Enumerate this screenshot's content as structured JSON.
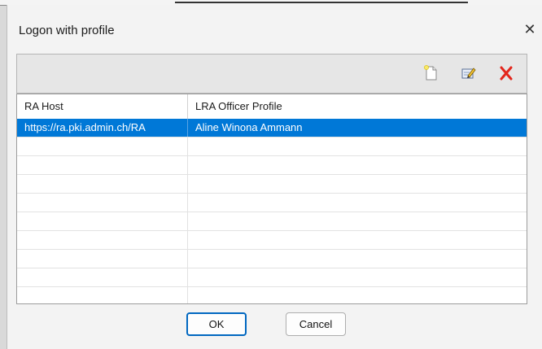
{
  "dialog": {
    "title": "Logon with profile",
    "close_glyph": "✕"
  },
  "toolbar": {
    "buttons": [
      {
        "name": "new-profile-button",
        "icon": "new-document-icon"
      },
      {
        "name": "edit-profile-button",
        "icon": "edit-icon"
      },
      {
        "name": "delete-profile-button",
        "icon": "delete-x-icon"
      }
    ]
  },
  "table": {
    "columns": [
      "RA Host",
      "LRA Officer Profile"
    ],
    "rows": [
      {
        "host": "https://ra.pki.admin.ch/RA",
        "profile": "Aline Winona Ammann",
        "selected": true
      }
    ],
    "empty_rows": 9
  },
  "buttons": {
    "ok_label": "OK",
    "cancel_label": "Cancel"
  },
  "colors": {
    "selection": "#0078d7",
    "delete_red": "#e3261c",
    "ok_border": "#0067c0"
  }
}
